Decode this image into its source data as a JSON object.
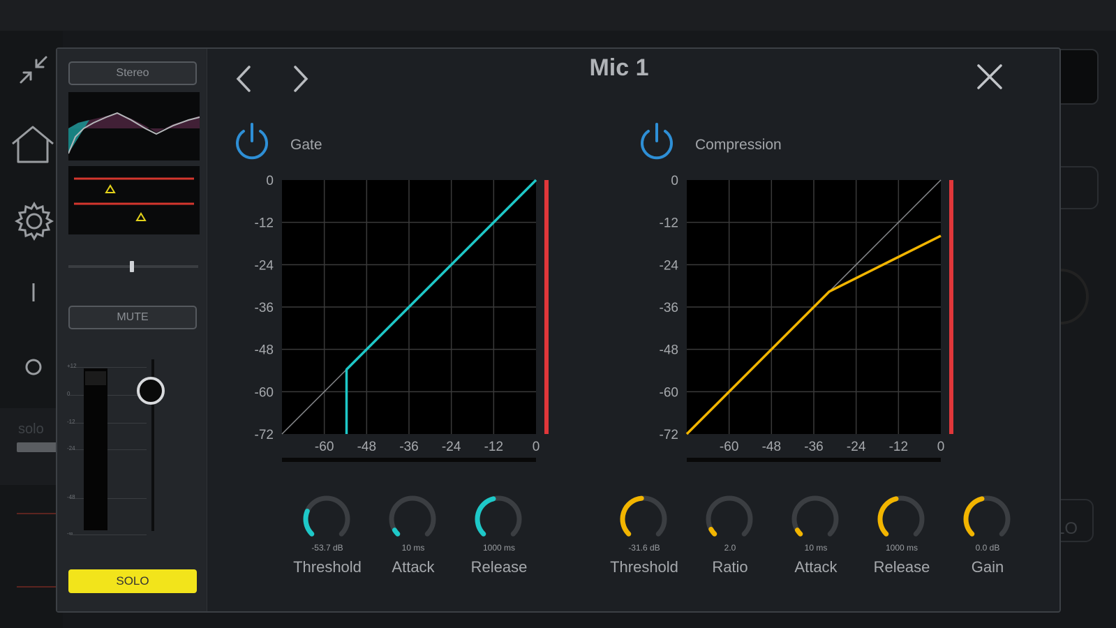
{
  "dialog": {
    "title": "Mic 1"
  },
  "sidebar": {
    "mode_label": "Stereo",
    "mute_label": "MUTE",
    "solo_label": "SOLO",
    "fader_scale": [
      "+12",
      "0",
      "-12",
      "-24",
      "-48",
      "-∞"
    ],
    "pan_position": 0.5
  },
  "background": {
    "solo_label": "solo",
    "lo_label": "LO"
  },
  "gate": {
    "label": "Gate",
    "enabled": true,
    "y_ticks": [
      "0",
      "-12",
      "-24",
      "-36",
      "-48",
      "-60",
      "-72"
    ],
    "x_ticks": [
      "-60",
      "-48",
      "-36",
      "-24",
      "-12",
      "0"
    ],
    "knobs": [
      {
        "name": "Threshold",
        "value": "-53.7 dB",
        "level": 0.25
      },
      {
        "name": "Attack",
        "value": "10 ms",
        "level": 0.05
      },
      {
        "name": "Release",
        "value": "1000 ms",
        "level": 0.45
      }
    ]
  },
  "compression": {
    "label": "Compression",
    "enabled": true,
    "y_ticks": [
      "0",
      "-12",
      "-24",
      "-36",
      "-48",
      "-60",
      "-72"
    ],
    "x_ticks": [
      "-60",
      "-48",
      "-36",
      "-24",
      "-12",
      "0"
    ],
    "knobs": [
      {
        "name": "Threshold",
        "value": "-31.6 dB",
        "level": 0.48
      },
      {
        "name": "Ratio",
        "value": "2.0",
        "level": 0.06
      },
      {
        "name": "Attack",
        "value": "10 ms",
        "level": 0.05
      },
      {
        "name": "Release",
        "value": "1000 ms",
        "level": 0.45
      },
      {
        "name": "Gain",
        "value": "0.0 dB",
        "level": 0.45
      }
    ]
  },
  "colors": {
    "gate_accent": "#1ec8c8",
    "comp_accent": "#f2b500",
    "power_blue": "#2e8fd6",
    "meter_red": "#e0373a",
    "solo_yellow": "#f2e41b"
  },
  "chart_data": [
    {
      "type": "line",
      "title": "Gate",
      "xlim": [
        -72,
        0
      ],
      "ylim": [
        -72,
        0
      ],
      "x_ticks": [
        -60,
        -48,
        -36,
        -24,
        -12,
        0
      ],
      "y_ticks": [
        0,
        -12,
        -24,
        -36,
        -48,
        -60,
        -72
      ],
      "grid": true,
      "series": [
        {
          "role": "unity",
          "x": [
            -72,
            0
          ],
          "y": [
            -72,
            0
          ]
        },
        {
          "role": "curve",
          "x": [
            -53.7,
            -53.7,
            0
          ],
          "y": [
            -72,
            -53.7,
            0
          ]
        }
      ]
    },
    {
      "type": "line",
      "title": "Compression",
      "xlim": [
        -72,
        0
      ],
      "ylim": [
        -72,
        0
      ],
      "x_ticks": [
        -60,
        -48,
        -36,
        -24,
        -12,
        0
      ],
      "y_ticks": [
        0,
        -12,
        -24,
        -36,
        -48,
        -60,
        -72
      ],
      "grid": true,
      "series": [
        {
          "role": "unity",
          "x": [
            -72,
            0
          ],
          "y": [
            -72,
            0
          ]
        },
        {
          "role": "curve",
          "x": [
            -72,
            -31.6,
            0
          ],
          "y": [
            -72,
            -31.6,
            -15.8
          ]
        }
      ]
    }
  ]
}
